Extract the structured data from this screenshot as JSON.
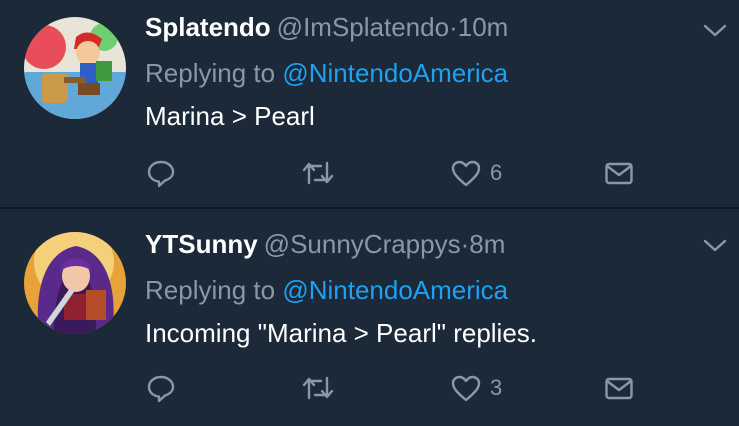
{
  "colors": {
    "background": "#1c2938",
    "secondary_text": "#8899a6",
    "accent_link": "#1da1f2",
    "primary_text": "#ffffff"
  },
  "tweets": [
    {
      "display_name": "Splatendo",
      "handle": "@ImSplatendo",
      "separator": "·",
      "time": "10m",
      "replying_prefix": "Replying to",
      "replying_to": "@NintendoAmerica",
      "text": "Marina > Pearl",
      "like_count": "6",
      "icons": [
        "reply-icon",
        "retweet-icon",
        "heart-icon",
        "direct-message-icon",
        "chevron-down-icon"
      ]
    },
    {
      "display_name": "YTSunny",
      "handle": "@SunnyCrappys",
      "separator": "·",
      "time": "8m",
      "replying_prefix": "Replying to",
      "replying_to": "@NintendoAmerica",
      "text": "Incoming \"Marina > Pearl\" replies.",
      "like_count": "3",
      "icons": [
        "reply-icon",
        "retweet-icon",
        "heart-icon",
        "direct-message-icon",
        "chevron-down-icon"
      ]
    }
  ]
}
